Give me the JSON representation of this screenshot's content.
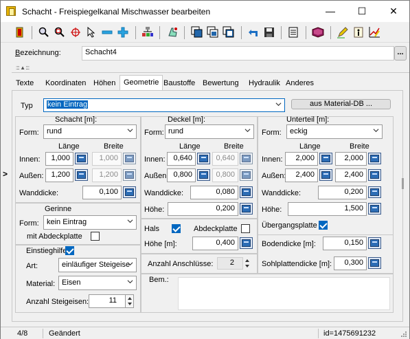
{
  "window": {
    "title": "Schacht - Freispiegelkanal Mischwasser bearbeiten",
    "minimize": "—",
    "maximize": "☐",
    "close": "✕"
  },
  "toolbar": {
    "icons": [
      "exit-icon",
      "zoom-icon",
      "zoom-window-icon",
      "crosshair-icon",
      "pointer-icon",
      "zoom-minus-icon",
      "zoom-plus-icon",
      "network-icon",
      "hand-pointer-icon",
      "layers-icon",
      "layers-edit-icon",
      "layers-copy-icon",
      "undo-icon",
      "save-icon",
      "document-icon",
      "book-icon",
      "pen-icon",
      "info-doc-icon",
      "chart-edit-icon"
    ]
  },
  "header": {
    "bezeichnung_label": "Bezeichnung:",
    "bezeichnung_value": "Schacht4",
    "more_button": "...",
    "handle": ":::: ▲ ::::"
  },
  "tabs": [
    "Texte",
    "Koordinaten",
    "Höhen",
    "Geometrie",
    "Baustoffe",
    "Bewertung",
    "Hydraulik",
    "Anderes"
  ],
  "active_tab": "Geometrie",
  "geometrie": {
    "typ_label": "Typ",
    "typ_value": "kein Eintrag",
    "material_db_button": "aus Material-DB ...",
    "schacht": {
      "title": "Schacht [m]:",
      "form_label": "Form:",
      "form_value": "rund",
      "laenge_header": "Länge",
      "breite_header": "Breite",
      "innen_label": "Innen:",
      "innen_laenge": "1,000",
      "innen_breite": "1,000",
      "aussen_label": "Außen:",
      "aussen_laenge": "1,200",
      "aussen_breite": "1,200",
      "wanddicke_label": "Wanddicke:",
      "wanddicke_value": "0,100"
    },
    "gerinne": {
      "title": "Gerinne",
      "form_label": "Form:",
      "form_value": "kein Eintrag",
      "abdeckplatte_label": "mit Abdeckplatte",
      "abdeckplatte_checked": false
    },
    "einstieg": {
      "title": "Einstieghilfe",
      "checked": true,
      "art_label": "Art:",
      "art_value": "einläufiger Steigeise",
      "material_label": "Material:",
      "material_value": "Eisen",
      "anzahl_label": "Anzahl Steigeisen:",
      "anzahl_value": "11"
    },
    "deckel": {
      "title": "Deckel [m]:",
      "form_label": "Form:",
      "form_value": "rund",
      "laenge_header": "Länge",
      "breite_header": "Breite",
      "innen_label": "Innen:",
      "innen_laenge": "0,640",
      "innen_breite": "0,640",
      "aussen_label": "Außen:",
      "aussen_laenge": "0,800",
      "aussen_breite": "0,800",
      "wanddicke_label": "Wanddicke:",
      "wanddicke_value": "0,080",
      "hoehe_label": "Höhe:",
      "hoehe_value": "0,200"
    },
    "hals": {
      "label": "Hals",
      "checked": true,
      "abdeckplatte_label": "Abdeckplatte",
      "abdeckplatte_checked": false,
      "hoehe_label": "Höhe [m]:",
      "hoehe_value": "0,400"
    },
    "anschluesse": {
      "label": "Anzahl Anschlüsse:",
      "value": "2"
    },
    "bem_label": "Bem.:",
    "unterteil": {
      "title": "Unterteil [m]:",
      "form_label": "Form:",
      "form_value": "eckig",
      "laenge_header": "Länge",
      "breite_header": "Breite",
      "innen_label": "Innen:",
      "innen_laenge": "2,000",
      "innen_breite": "2,000",
      "aussen_label": "Außen:",
      "aussen_laenge": "2,400",
      "aussen_breite": "2,400",
      "wanddicke_label": "Wanddicke:",
      "wanddicke_value": "0,200",
      "hoehe_label": "Höhe:",
      "hoehe_value": "1,500",
      "uebergangsplatte_label": "Übergangsplatte",
      "uebergangsplatte_checked": true,
      "bodendicke_label": "Bodendicke [m]:",
      "bodendicke_value": "0,150",
      "sohlplattendicke_label": "Sohlplattendicke [m]:",
      "sohlplattendicke_value": "0,300"
    }
  },
  "status": {
    "record": "4/8",
    "state": "Geändert",
    "id": "id=1475691232"
  },
  "side_arrow": ">",
  "colors": {
    "selection": "#0067c0",
    "title_bg": "#ffffff",
    "panel_bg": "#f0f0f0"
  }
}
